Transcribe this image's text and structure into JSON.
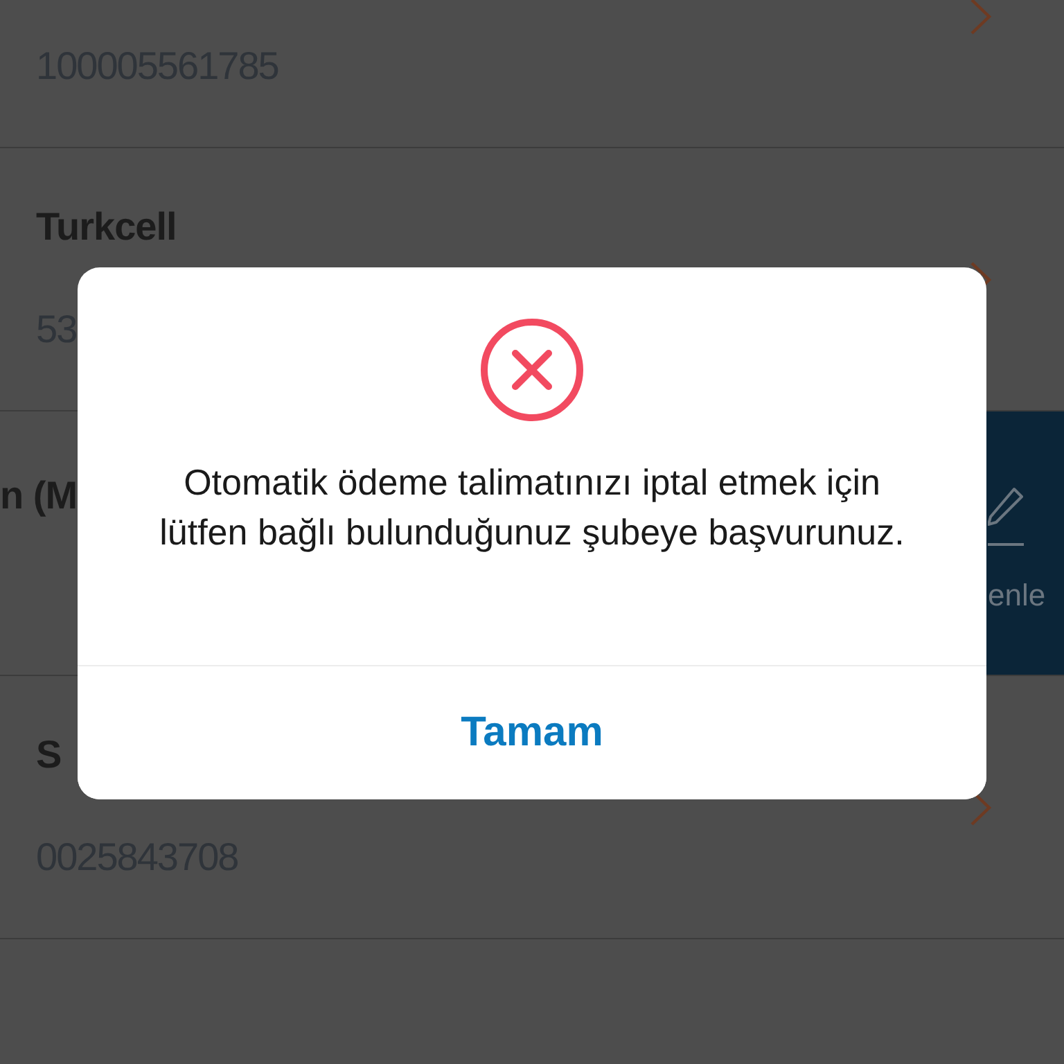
{
  "list": {
    "rows": [
      {
        "kind": "item",
        "subtitle": "100005561785"
      },
      {
        "kind": "item",
        "title": "Turkcell",
        "subtitle": "53"
      },
      {
        "kind": "swiped",
        "title": "n (M",
        "action": "enle"
      },
      {
        "kind": "item",
        "title": "S",
        "subtitle": "0025843708"
      }
    ]
  },
  "dialog": {
    "message": "Otomatik ödeme talimatınızı iptal etmek için lütfen bağlı bulunduğunuz şubeye başvurunuz.",
    "button": "Tamam"
  }
}
